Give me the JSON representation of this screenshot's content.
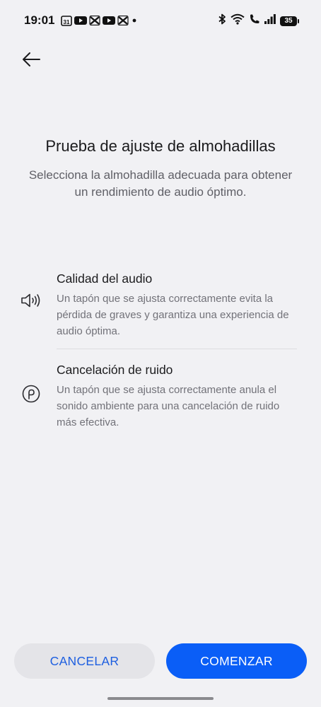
{
  "status_bar": {
    "time": "19:01",
    "calendar_badge": "31",
    "battery_level": "35",
    "left_icons": [
      "calendar-icon",
      "youtube-icon",
      "capcut-icon",
      "youtube-icon",
      "capcut-icon",
      "dot-icon"
    ],
    "right_icons": [
      "bluetooth-icon",
      "wifi-icon",
      "wifi-call-icon",
      "signal-icon",
      "battery-icon"
    ]
  },
  "header": {
    "back_icon": "arrow-left-icon"
  },
  "intro": {
    "title": "Prueba de ajuste de almohadillas",
    "subtitle": "Selecciona la almohadilla adecuada para obtener un rendimiento de audio óptimo."
  },
  "features": [
    {
      "icon": "speaker-icon",
      "title": "Calidad del audio",
      "description": "Un tapón que se ajusta correctamente evita la pérdida de graves y garantiza una experiencia de audio óptima."
    },
    {
      "icon": "earbud-icon",
      "title": "Cancelación de ruido",
      "description": "Un tapón que se ajusta correctamente anula el sonido ambiente para una cancelación de ruido más efectiva."
    }
  ],
  "actions": {
    "cancel_label": "CANCELAR",
    "start_label": "COMENZAR"
  },
  "colors": {
    "background": "#f1f1f4",
    "primary": "#0a5ef7",
    "cancel_text": "#1e5fe0",
    "cancel_bg": "#e4e4e8"
  }
}
